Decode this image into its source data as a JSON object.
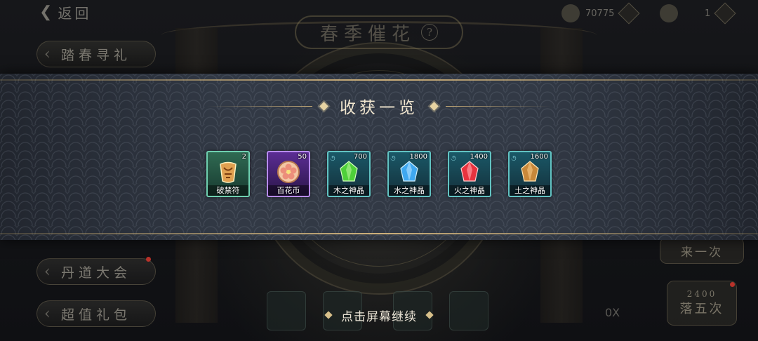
{
  "background": {
    "back_label": "返回",
    "title": "春季催花",
    "help_icon": "?",
    "currency_value": "70775",
    "second_currency_value": "1",
    "side_menu": [
      {
        "label": "踏春寻礼"
      },
      {
        "label": "丹道大会"
      },
      {
        "label": "超值礼包"
      }
    ],
    "right_button_top": "来一次",
    "right_button_bottom_cost": "2400",
    "right_button_bottom_label": "落五次",
    "slot_text": "0X"
  },
  "results": {
    "heading": "收获一览",
    "items": [
      {
        "name": "破禁符",
        "qty": "2",
        "icon": "talisman-scroll-icon",
        "frame": "green",
        "color": "#e0a050"
      },
      {
        "name": "百花币",
        "qty": "50",
        "icon": "flower-coin-icon",
        "frame": "purple",
        "color": "#f0b8a0"
      },
      {
        "name": "木之神晶",
        "qty": "700",
        "icon": "wood-crystal-icon",
        "frame": "teal",
        "color": "#4ed03a"
      },
      {
        "name": "水之神晶",
        "qty": "1800",
        "icon": "water-crystal-icon",
        "frame": "teal",
        "color": "#3fa8f0"
      },
      {
        "name": "火之神晶",
        "qty": "1400",
        "icon": "fire-crystal-icon",
        "frame": "teal",
        "color": "#e8333f"
      },
      {
        "name": "土之神晶",
        "qty": "1600",
        "icon": "earth-crystal-icon",
        "frame": "teal",
        "color": "#c8883a"
      }
    ],
    "continue_hint": "点击屏幕继续"
  },
  "colors": {
    "accent_gold": "#cdb07a",
    "banner": "#313844",
    "frame_teal": "#62c3c3",
    "frame_purple": "#b78cf0"
  }
}
